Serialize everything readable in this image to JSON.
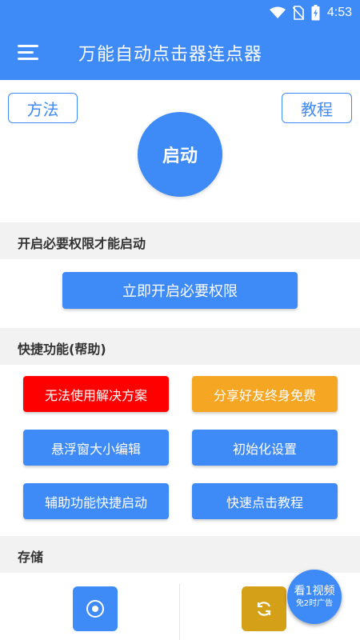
{
  "status_bar": {
    "time": "4:53",
    "icons": [
      "wifi-icon",
      "no-sim-icon",
      "battery-charging-icon"
    ]
  },
  "app_bar": {
    "title": "万能自动点击器连点器",
    "menu_icon": "hamburger-menu-icon"
  },
  "top": {
    "method_label": "方法",
    "tutorial_label": "教程",
    "start_label": "启动"
  },
  "permissions": {
    "header": "开启必要权限才能启动",
    "button_label": "立即开启必要权限"
  },
  "quick": {
    "header": "快捷功能(帮助)",
    "buttons": [
      {
        "label": "无法使用解决方案",
        "color": "#ff0000"
      },
      {
        "label": "分享好友终身免费",
        "color": "#f5a623"
      },
      {
        "label": "悬浮窗大小编辑",
        "color": "#3e8af6"
      },
      {
        "label": "初始化设置",
        "color": "#3e8af6"
      },
      {
        "label": "辅助功能快捷启动",
        "color": "#3e8af6"
      },
      {
        "label": "快速点击教程",
        "color": "#3e8af6"
      }
    ]
  },
  "storage": {
    "header": "存储",
    "items": [
      {
        "icon": "target-circle-icon",
        "color": "#3e8af6"
      },
      {
        "icon": "refresh-icon",
        "color": "#d4a017"
      }
    ]
  },
  "video_badge": {
    "main": "看1视频",
    "sub": "免2时广告"
  },
  "colors": {
    "primary": "#3e8af6",
    "section_bg": "#f2f2f2"
  }
}
